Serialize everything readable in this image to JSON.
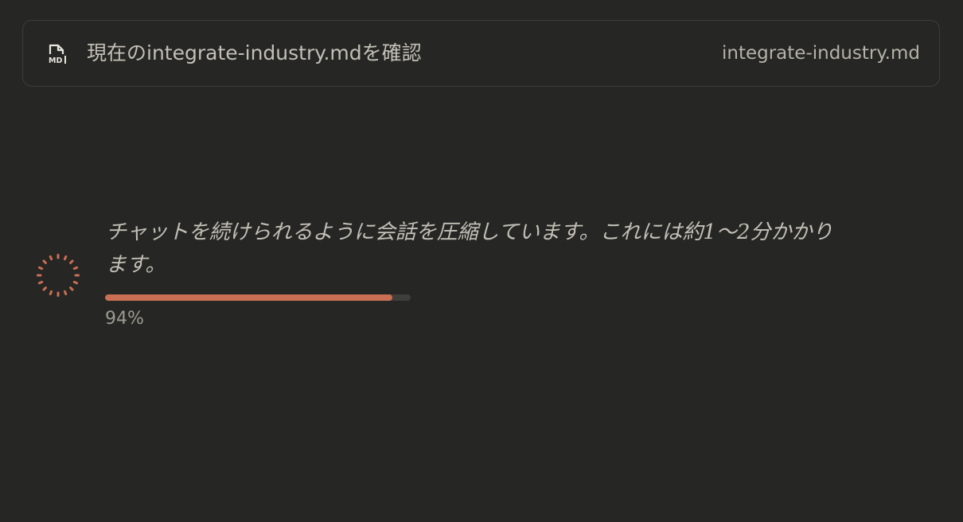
{
  "file_card": {
    "icon": "markdown-file-icon",
    "title": "現在のintegrate-industry.mdを確認",
    "file_name": "integrate-industry.md"
  },
  "status": {
    "spinner_icon": "loading-spinner-icon",
    "message": "チャットを続けられるように会話を圧縮しています。これには約1〜2分かかります。",
    "progress_fraction": 0.94,
    "progress_label": "94%",
    "accent_color": "#c96f53"
  }
}
